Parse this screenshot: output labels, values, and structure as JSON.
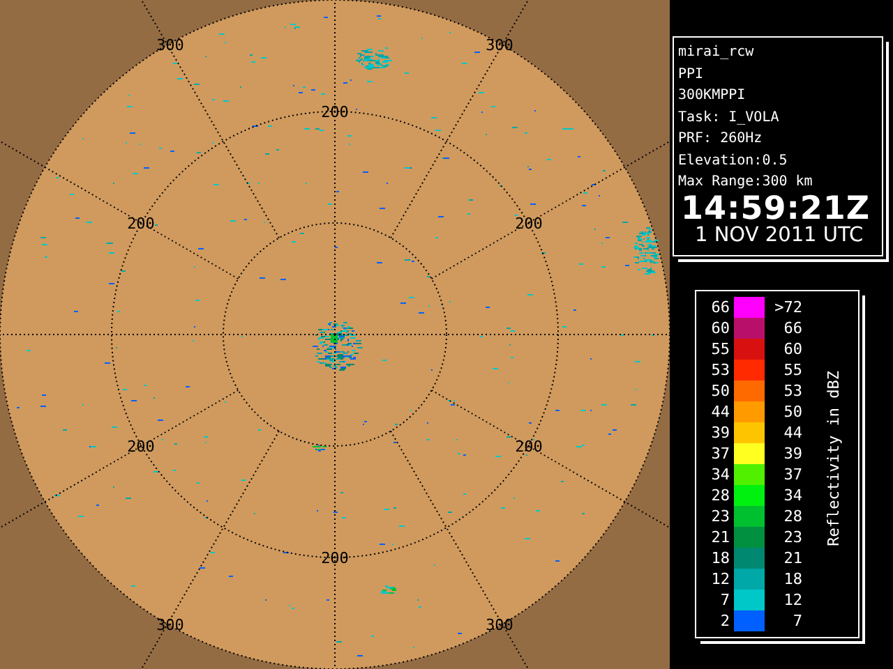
{
  "radar": {
    "range_labels": [
      {
        "text": "300"
      },
      {
        "text": "300"
      },
      {
        "text": "200"
      },
      {
        "text": "200"
      },
      {
        "text": "200"
      },
      {
        "text": "200"
      },
      {
        "text": "200"
      },
      {
        "text": "200"
      },
      {
        "text": "300"
      },
      {
        "text": "300"
      }
    ]
  },
  "info": {
    "lines": [
      "mirai_rcw",
      "PPI",
      "300KMPPI",
      "Task: I_VOLA",
      "PRF: 260Hz",
      "Elevation:0.5",
      "Max Range:300 km"
    ],
    "time": "14:59:21Z",
    "date": "1 NOV 2011 UTC"
  },
  "legend": {
    "title": "Reflectivity in dBZ",
    "rows": [
      {
        "low": "66",
        "high": ">72",
        "color": "#ff00ff"
      },
      {
        "low": "60",
        "high": "66",
        "color": "#b8106a"
      },
      {
        "low": "55",
        "high": "60",
        "color": "#d81010"
      },
      {
        "low": "53",
        "high": "55",
        "color": "#ff2a00"
      },
      {
        "low": "50",
        "high": "53",
        "color": "#ff6a00"
      },
      {
        "low": "44",
        "high": "50",
        "color": "#ff9a00"
      },
      {
        "low": "39",
        "high": "44",
        "color": "#ffc400"
      },
      {
        "low": "37",
        "high": "39",
        "color": "#ffff20"
      },
      {
        "low": "34",
        "high": "37",
        "color": "#50f000"
      },
      {
        "low": "28",
        "high": "34",
        "color": "#00f010"
      },
      {
        "low": "23",
        "high": "28",
        "color": "#00c030"
      },
      {
        "low": "21",
        "high": "23",
        "color": "#009040"
      },
      {
        "low": "18",
        "high": "21",
        "color": "#008870"
      },
      {
        "low": "12",
        "high": "18",
        "color": "#00a8a8"
      },
      {
        "low": "7",
        "high": "12",
        "color": "#00c8c8"
      },
      {
        "low": "2",
        "high": "7",
        "color": "#0060ff"
      }
    ]
  }
}
